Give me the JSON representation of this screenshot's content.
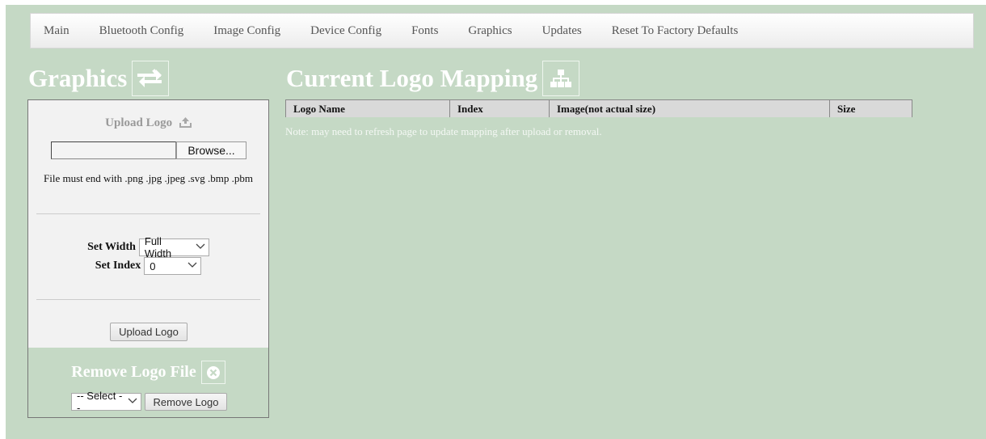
{
  "nav": {
    "items": [
      "Main",
      "Bluetooth Config",
      "Image Config",
      "Device Config",
      "Fonts",
      "Graphics",
      "Updates",
      "Reset To Factory Defaults"
    ]
  },
  "left": {
    "title": "Graphics",
    "title_icon": "swap-arrows-icon",
    "upload": {
      "title": "Upload Logo",
      "icon": "upload-icon",
      "file_value": "",
      "browse_label": "Browse...",
      "hint": "File must end with .png .jpg .jpeg .svg .bmp .pbm",
      "width_label": "Set Width",
      "width_value": "Full Width",
      "index_label": "Set Index",
      "index_value": "0",
      "button_label": "Upload Logo"
    },
    "remove": {
      "title": "Remove Logo File",
      "icon": "close-circle-icon",
      "select_value": "-- Select --",
      "button_label": "Remove Logo"
    }
  },
  "mapping": {
    "title": "Current Logo Mapping",
    "title_icon": "sitemap-icon",
    "columns": [
      "Logo Name",
      "Index",
      "Image(not actual size)",
      "Size"
    ],
    "note": "Note: may need to refresh page to update mapping after upload or removal."
  },
  "colors": {
    "page_bg": "#c5d9c5",
    "panel_bg": "#f2f2f2",
    "heading_text": "#ffffff"
  }
}
